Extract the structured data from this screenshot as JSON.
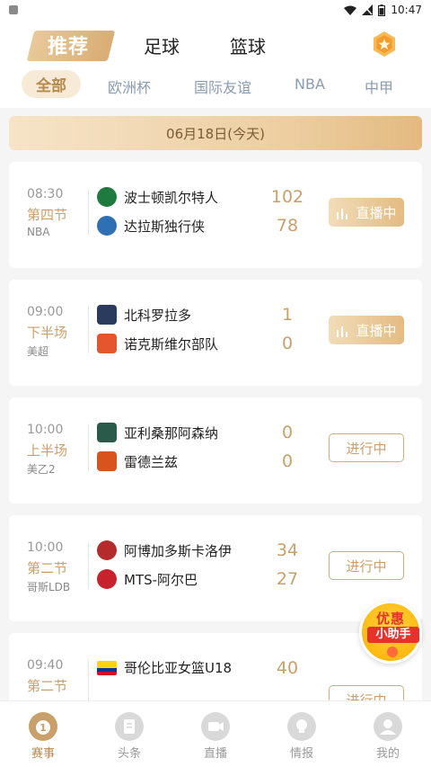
{
  "status_bar": {
    "time": "10:47"
  },
  "header": {
    "tabs": [
      {
        "label": "推荐",
        "active": true
      },
      {
        "label": "足球",
        "active": false
      },
      {
        "label": "篮球",
        "active": false
      }
    ],
    "medal_icon": "medal-icon"
  },
  "sub_tabs": [
    {
      "label": "全部",
      "active": true
    },
    {
      "label": "欧洲杯",
      "active": false
    },
    {
      "label": "国际友谊",
      "active": false
    },
    {
      "label": "NBA",
      "active": false
    },
    {
      "label": "中甲",
      "active": false
    }
  ],
  "date_label": "06月18日(今天)",
  "matches": [
    {
      "time": "08:30",
      "period": "第四节",
      "league": "NBA",
      "home": {
        "name": "波士顿凯尔特人",
        "score": "102",
        "logo_color": "#1f7a3f"
      },
      "away": {
        "name": "达拉斯独行侠",
        "score": "78",
        "logo_color": "#2f6fb3"
      },
      "status": "直播中",
      "status_type": "live"
    },
    {
      "time": "09:00",
      "period": "下半场",
      "league": "美超",
      "home": {
        "name": "北科罗拉多",
        "score": "1",
        "logo_color": "#2b3b5e"
      },
      "away": {
        "name": "诺克斯维尔部队",
        "score": "0",
        "logo_color": "#e6562e"
      },
      "status": "直播中",
      "status_type": "live"
    },
    {
      "time": "10:00",
      "period": "上半场",
      "league": "美乙2",
      "home": {
        "name": "亚利桑那阿森纳",
        "score": "0",
        "logo_color": "#2a5a4a"
      },
      "away": {
        "name": "雷德兰兹",
        "score": "0",
        "logo_color": "#d9531e"
      },
      "status": "进行中",
      "status_type": "progress"
    },
    {
      "time": "10:00",
      "period": "第二节",
      "league": "哥斯LDB",
      "home": {
        "name": "阿博加多斯卡洛伊",
        "score": "34",
        "logo_color": "#b52a2a"
      },
      "away": {
        "name": "MTS-阿尔巴",
        "score": "27",
        "logo_color": "#c8232c"
      },
      "status": "进行中",
      "status_type": "progress"
    },
    {
      "time": "09:40",
      "period": "第二节",
      "league": "",
      "home": {
        "name": "哥伦比亚女篮U18",
        "score": "40",
        "logo_color": "#fcd116"
      },
      "away": {
        "name": "",
        "score": "",
        "logo_color": "#cccccc"
      },
      "status": "进行中",
      "status_type": "progress"
    }
  ],
  "float_helper": {
    "line1": "优惠",
    "line2": "小助手"
  },
  "bottom_nav": [
    {
      "label": "赛事",
      "active": true,
      "icon": "trophy-icon"
    },
    {
      "label": "头条",
      "active": false,
      "icon": "news-icon"
    },
    {
      "label": "直播",
      "active": false,
      "icon": "video-icon"
    },
    {
      "label": "情报",
      "active": false,
      "icon": "bulb-icon"
    },
    {
      "label": "我的",
      "active": false,
      "icon": "profile-icon"
    }
  ],
  "colors": {
    "accent": "#c9a06b",
    "live_gradient": [
      "#f2dcb9",
      "#e4bb83"
    ]
  }
}
